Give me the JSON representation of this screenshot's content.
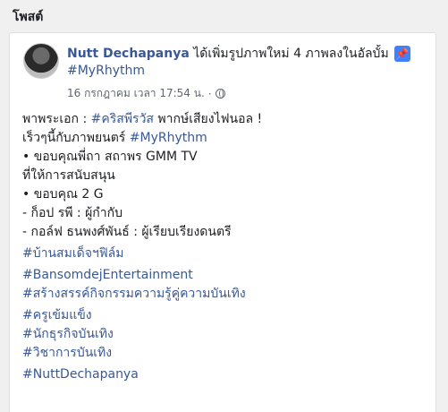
{
  "section_title": "โพสต์",
  "post": {
    "author": "Nutt Dechapanya",
    "action": " ได้เพิ่มรูปภาพใหม่ 4 ภาพลงในอัลบั้ม",
    "album": "#MyRhythm",
    "timestamp": "16 กรกฎาคม เวลา 17:54 น.",
    "privacy_icon": "globe-icon",
    "pin_icon": "pin-icon",
    "body": {
      "l1_pre": "พาพระเอก : ",
      "l1_tag": "#คริสพีรวัส",
      "l1_post": " พากษ์เสียงไฟนอล !",
      "l2_pre": "เร็วๆนี้กับภาพยนตร์ ",
      "l2_tag": "#MyRhythm",
      "l3": "• ขอบคุณพี่ถา สถาพร GMM TV",
      "l4": "ที่ให้การสนับสนุน",
      "l5": "• ขอบคุณ 2 G",
      "l6": "- ก็อป รพี : ผู้กำกับ",
      "l7": "- กอล์ฟ ธนพงศ์พันธ์ : ผู้เรียบเรียงดนตรี",
      "h1": "#บ้านสมเด็จฯฟิล์ม",
      "h2": "#BansomdejEntertainment",
      "h3": "#สร้างสรรค์กิจกรรมความรู้คู่ความบันเทิง",
      "h4": "#ครูเข้มแข็ง",
      "h5": "#นักธุรกิจบันเทิง",
      "h6": "#วิชาการบันเทิง",
      "h7": "#NuttDechapanya"
    }
  }
}
